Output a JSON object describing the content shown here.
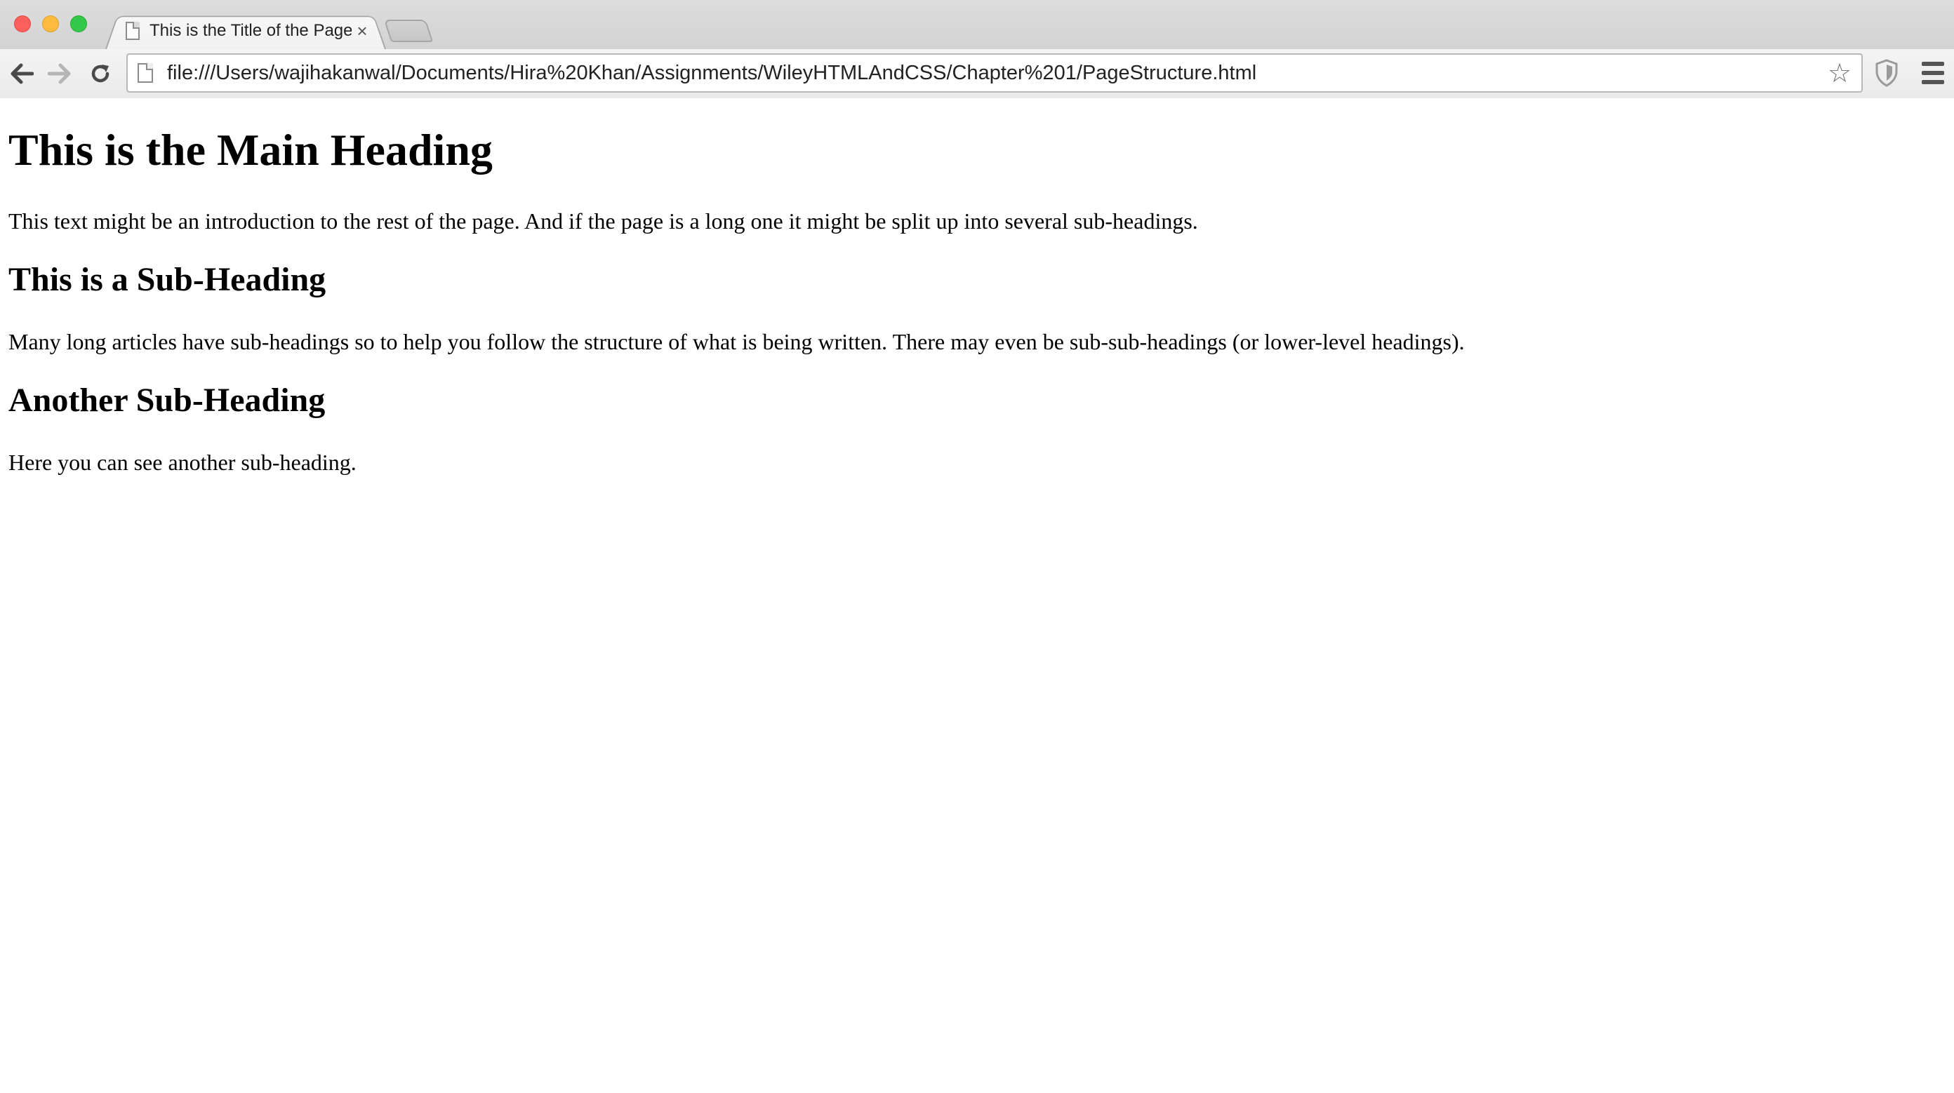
{
  "browser": {
    "tab_title": "This is the Title of the Page",
    "tab_close": "×",
    "url": "file:///Users/wajihakanwal/Documents/Hira%20Khan/Assignments/WileyHTMLAndCSS/Chapter%201/PageStructure.html",
    "icons": {
      "back": "arrow-left-icon",
      "forward": "arrow-right-icon",
      "reload": "reload-icon",
      "bookmark": "star-icon",
      "extension": "shield-icon",
      "menu": "hamburger-menu-icon"
    },
    "colors": {
      "close": "#fc605c",
      "minimize": "#fdbc40",
      "maximize": "#34c84a"
    }
  },
  "page": {
    "main_heading": "This is the Main Heading",
    "intro": "This text might be an introduction to the rest of the page. And if the page is a long one it might be split up into several sub-headings.",
    "subheading_1": "This is a Sub-Heading",
    "paragraph_1": "Many long articles have sub-headings so to help you follow the structure of what is being written. There may even be sub-sub-headings (or lower-level headings).",
    "subheading_2": "Another Sub-Heading",
    "paragraph_2": "Here you can see another sub-heading."
  }
}
